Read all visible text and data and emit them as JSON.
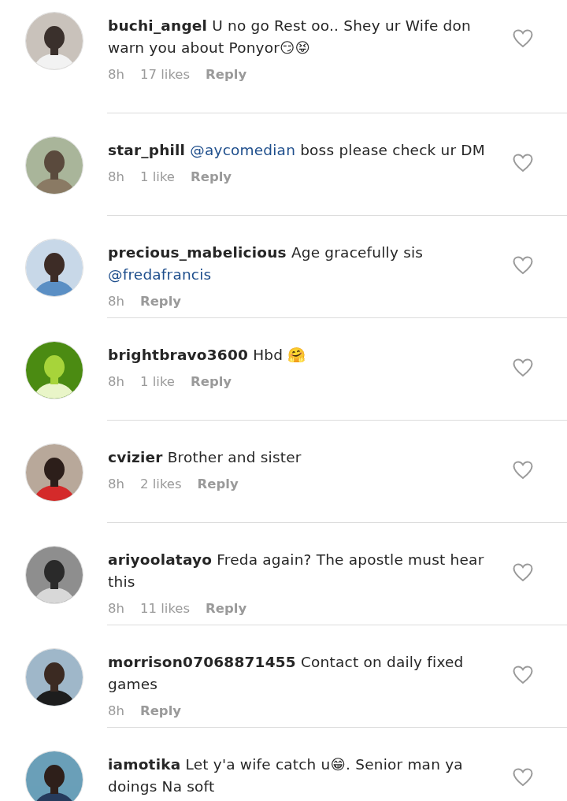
{
  "comments": [
    {
      "username": "buchi_angel",
      "body": [
        {
          "kind": "plain",
          "text": "U no go Rest oo.. Shey ur Wife don warn you about Ponyor😏😝"
        }
      ],
      "time": "8h",
      "likes": "17 likes",
      "reply": "Reply",
      "liked": false
    },
    {
      "username": "star_phill",
      "body": [
        {
          "kind": "mention",
          "text": "@aycomedian"
        },
        {
          "kind": "plain",
          "text": " boss please check ur DM"
        }
      ],
      "time": "8h",
      "likes": "1 like",
      "reply": "Reply",
      "liked": false
    },
    {
      "username": "precious_mabelicious",
      "body": [
        {
          "kind": "plain",
          "text": "Age gracefully sis "
        },
        {
          "kind": "mention",
          "text": "@fredafrancis"
        }
      ],
      "time": "8h",
      "reply": "Reply",
      "liked": false
    },
    {
      "username": "brightbravo3600",
      "body": [
        {
          "kind": "plain",
          "text": "Hbd 🤗"
        }
      ],
      "time": "8h",
      "likes": "1 like",
      "reply": "Reply",
      "liked": false
    },
    {
      "username": "cvizier",
      "body": [
        {
          "kind": "plain",
          "text": "Brother and sister"
        }
      ],
      "time": "8h",
      "likes": "2 likes",
      "reply": "Reply",
      "liked": false
    },
    {
      "username": "ariyoolatayo",
      "body": [
        {
          "kind": "plain",
          "text": "Freda again? The apostle must hear this"
        }
      ],
      "time": "8h",
      "likes": "11 likes",
      "reply": "Reply",
      "liked": false
    },
    {
      "username": "morrison07068871455",
      "body": [
        {
          "kind": "plain",
          "text": "Contact on daily fixed games"
        }
      ],
      "time": "8h",
      "reply": "Reply",
      "liked": false
    },
    {
      "username": "iamotika",
      "body": [
        {
          "kind": "plain",
          "text": "Let y'a wife catch u😁. Senior man ya doings Na soft"
        }
      ],
      "liked": false
    }
  ]
}
